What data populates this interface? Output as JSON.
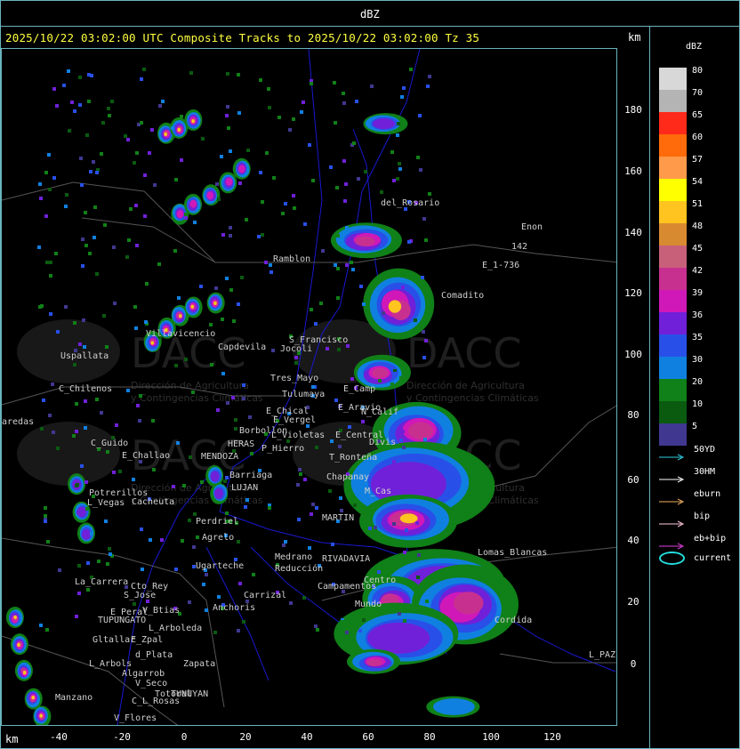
{
  "window": {
    "unit_title": "dBZ"
  },
  "header": {
    "title": "2025/10/22 03:02:00 UTC Composite Tracks to 2025/10/22 03:02:00 Tz 35",
    "km_label": "km"
  },
  "axes": {
    "km_label": "km",
    "y_ticks": [
      "180",
      "160",
      "140",
      "120",
      "100",
      "80",
      "60",
      "40",
      "20",
      "0"
    ],
    "x_ticks": [
      "-40",
      "-20",
      "0",
      "20",
      "40",
      "60",
      "80",
      "100",
      "120"
    ]
  },
  "legend": {
    "title": "dBZ",
    "levels": [
      {
        "label": "80",
        "color": "#d8d8d8"
      },
      {
        "label": "70",
        "color": "#b4b4b4"
      },
      {
        "label": "65",
        "color": "#ff2a1a"
      },
      {
        "label": "60",
        "color": "#ff6a0a"
      },
      {
        "label": "57",
        "color": "#ff9a4a"
      },
      {
        "label": "54",
        "color": "#ffff00"
      },
      {
        "label": "51",
        "color": "#ffc420"
      },
      {
        "label": "48",
        "color": "#d88a30"
      },
      {
        "label": "45",
        "color": "#c8607a"
      },
      {
        "label": "42",
        "color": "#c83090"
      },
      {
        "label": "39",
        "color": "#d018b8"
      },
      {
        "label": "36",
        "color": "#7020d8"
      },
      {
        "label": "35",
        "color": "#2850e8"
      },
      {
        "label": "30",
        "color": "#1080e0"
      },
      {
        "label": "20",
        "color": "#108018"
      },
      {
        "label": "10",
        "color": "#0a5a10"
      },
      {
        "label": "5",
        "color": "#403890"
      }
    ],
    "tracks": [
      {
        "label": "50YD",
        "color": "#30d0e0"
      },
      {
        "label": "30HM",
        "color": "#ffffff"
      },
      {
        "label": "eburn",
        "color": "#f0b060"
      },
      {
        "label": "bip",
        "color": "#ffc8e0"
      },
      {
        "label": "eb+bip",
        "color": "#e040e0"
      }
    ],
    "current_label": "current"
  },
  "places": [
    {
      "name": "Uspallata"
    },
    {
      "name": "C_Chilenos"
    },
    {
      "name": "aredas"
    },
    {
      "name": "C_Guido"
    },
    {
      "name": "E_Challao"
    },
    {
      "name": "Potrerillos"
    },
    {
      "name": "L_Vegas"
    },
    {
      "name": "Cacheuta"
    },
    {
      "name": "Perdriel"
    },
    {
      "name": "Agrelo"
    },
    {
      "name": "Ugarteche"
    },
    {
      "name": "La_Carrera"
    },
    {
      "name": "Cto_Rey"
    },
    {
      "name": "S_Jose"
    },
    {
      "name": "E_Peral"
    },
    {
      "name": "TUPUNGATO"
    },
    {
      "name": "V_Btias"
    },
    {
      "name": "Anchoris"
    },
    {
      "name": "L_Arboleda"
    },
    {
      "name": "Gltallar"
    },
    {
      "name": "E_Zpal"
    },
    {
      "name": "L_Arbols"
    },
    {
      "name": "d_Plata"
    },
    {
      "name": "Zapata"
    },
    {
      "name": "Algarrob"
    },
    {
      "name": "V_Seco"
    },
    {
      "name": "Totoral"
    },
    {
      "name": "TUNUYAN"
    },
    {
      "name": "Manzano"
    },
    {
      "name": "C_L_Rosas"
    },
    {
      "name": "V_Flores"
    },
    {
      "name": "Ramblon"
    },
    {
      "name": "S_Francisco"
    },
    {
      "name": "Jocoli"
    },
    {
      "name": "Tres_Mayo"
    },
    {
      "name": "Tulumaya"
    },
    {
      "name": "E_Chical"
    },
    {
      "name": "E_Vergel"
    },
    {
      "name": "Borbollon"
    },
    {
      "name": "L_Violetas"
    },
    {
      "name": "P_Hierro"
    },
    {
      "name": "HERAS"
    },
    {
      "name": "MENDOZA"
    },
    {
      "name": "Barriaga"
    },
    {
      "name": "LUJAN"
    },
    {
      "name": "Capdevila"
    },
    {
      "name": "Villavicencio"
    },
    {
      "name": "E_Central"
    },
    {
      "name": "T_Ronteña"
    },
    {
      "name": "Chapanay"
    },
    {
      "name": "M_Cas"
    },
    {
      "name": "MARTIN"
    },
    {
      "name": "RIVADAVIA"
    },
    {
      "name": "Medrano"
    },
    {
      "name": "Reducción"
    },
    {
      "name": "Campamentos"
    },
    {
      "name": "Centro"
    },
    {
      "name": "Mundo"
    },
    {
      "name": "Lomas_Blancas"
    },
    {
      "name": "Cordida"
    },
    {
      "name": "L_PAZ"
    },
    {
      "name": "Carrizal"
    },
    {
      "name": "Enon"
    },
    {
      "name": "E_1-736"
    },
    {
      "name": "Comadito"
    },
    {
      "name": "del_Rosario"
    },
    {
      "name": "E_Camp"
    },
    {
      "name": "E_Aravio"
    },
    {
      "name": "N_Calif"
    },
    {
      "name": "Divis"
    },
    {
      "name": "142"
    }
  ],
  "watermark": {
    "brand": "DACC",
    "tagline1": "Dirección de Agricultura",
    "tagline2": "y Contingencias Climáticas"
  }
}
